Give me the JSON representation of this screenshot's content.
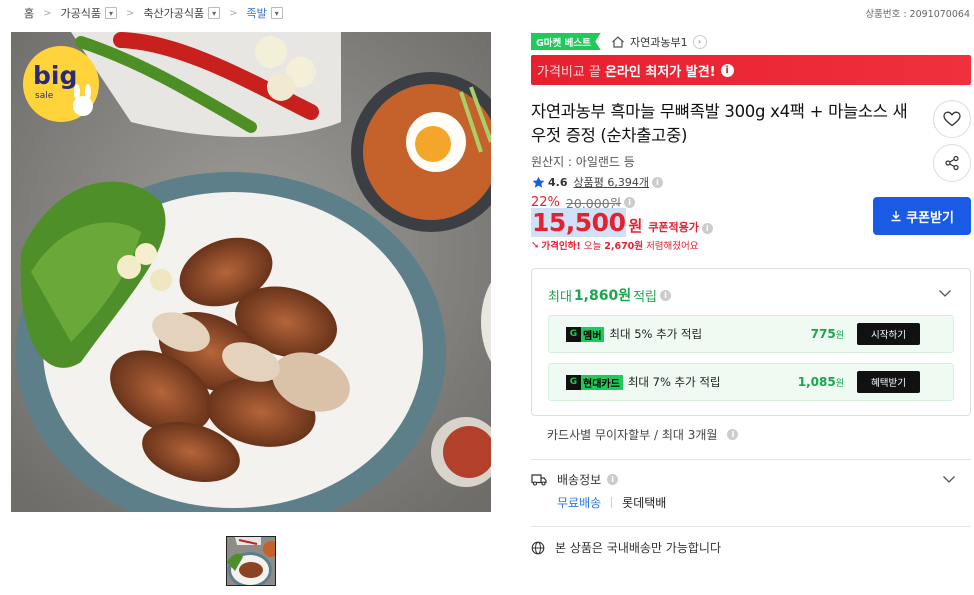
{
  "breadcrumb": {
    "items": [
      {
        "label": "홈"
      },
      {
        "label": "가공식품"
      },
      {
        "label": "축산가공식품"
      },
      {
        "label": "족발"
      }
    ]
  },
  "product_number": "상품번호 : 2091070064",
  "image": {
    "sale_badge_big": "big",
    "sale_badge_small": "sale"
  },
  "badge": {
    "label": "G마켓 베스트",
    "color": "#1fc95a"
  },
  "shop": {
    "name": "자연과농부1"
  },
  "lowest_banner": {
    "prefix": "가격비교 끝",
    "text": "온라인 최저가 발견!",
    "color": "#e7202f"
  },
  "title": "자연과농부 흑마늘 무뼈족발 300g x4팩 + 마늘소스 새우젓 증정 (순차출고중)",
  "origin": "원산지 : 아일랜드 등",
  "rating": {
    "score": "4.6",
    "reviews_label": "상품평",
    "reviews_count": "6,394개"
  },
  "price": {
    "discount_rate": "22%",
    "original": "20,000원",
    "sale": "15,500",
    "currency": "원",
    "coupon_applied": "쿠폰적용가",
    "drop_prefix": "가격인하!",
    "drop_text": "오늘",
    "drop_amount": "2,670원",
    "drop_suffix": "저렴해졌어요"
  },
  "coupon_button": "쿠폰받기",
  "rewards": {
    "head_prefix": "최대",
    "head_amount": "1,860원",
    "head_suffix": "적립",
    "rows": [
      {
        "tag": "멤버",
        "text": "최대 5% 추가 적립",
        "amount": "775",
        "unit": "원",
        "button": "시작하기"
      },
      {
        "tag": "현대카드",
        "text": "최대 7% 추가 적립",
        "amount": "1,085",
        "unit": "원",
        "button": "혜택받기"
      }
    ]
  },
  "installment": "카드사별 무이자할부 / 최대 3개월",
  "shipping": {
    "label": "배송정보",
    "free": "무료배송",
    "carrier": "롯데택배"
  },
  "domestic": "본 상품은 국내배송만 가능합니다"
}
